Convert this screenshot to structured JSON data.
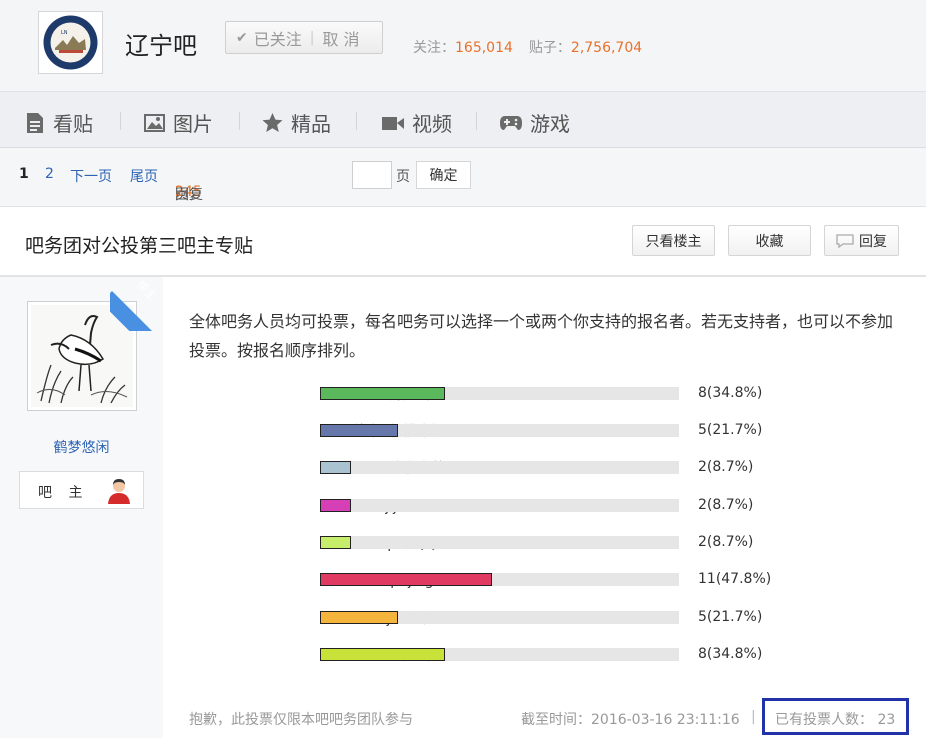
{
  "header": {
    "forum_name": "辽宁吧",
    "follow_button": {
      "check": "✔",
      "followed": "已关注",
      "sep": "|",
      "cancel": "取 消"
    },
    "follow_label": "关注：",
    "follow_count": "165,014",
    "posts_label": "贴子：",
    "posts_count": "2,756,704"
  },
  "nav": {
    "items": [
      {
        "label": "看贴",
        "icon": "document-icon"
      },
      {
        "label": "图片",
        "icon": "image-icon"
      },
      {
        "label": "精品",
        "icon": "star-icon"
      },
      {
        "label": "视频",
        "icon": "video-icon"
      },
      {
        "label": "游戏",
        "icon": "gamepad-icon"
      }
    ]
  },
  "pager": {
    "current": "1",
    "page2": "2",
    "next": "下一页",
    "last": "尾页",
    "reply_count": "245",
    "reply_text": "回复贴，共",
    "total_pages": "2",
    "pages_text": "页，跳到",
    "page_unit": "页",
    "ok": "确定"
  },
  "thread": {
    "title": "吧务团对公投第三吧主专贴",
    "buttons": {
      "only_op": "只看楼主",
      "favorite": "收藏",
      "reply": "回复"
    }
  },
  "post": {
    "badge": "楼主",
    "username": "鹤梦悠闲",
    "role": "吧 主",
    "body": "全体吧务人员均可投票，每名吧务可以选择一个或两个你支持的报名者。若无支持者，也可以不参加投票。按报名顺序排列。"
  },
  "poll": {
    "options": [
      {
        "name": "开元新人：",
        "votes": 8,
        "percent": 34.8,
        "result": "8(34.8%)",
        "color": "#5cb85c"
      },
      {
        "name": "蒙牛6核桃牛奶：",
        "votes": 5,
        "percent": 21.7,
        "result": "5(21.7%)",
        "color": "#6677aa"
      },
      {
        "name": "追求光芒：",
        "votes": 2,
        "percent": 8.7,
        "result": "2(8.7%)",
        "color": "#a9c4d0"
      },
      {
        "name": "jijia1993：",
        "votes": 2,
        "percent": 8.7,
        "result": "2(8.7%)",
        "color": "#d63fb5"
      },
      {
        "name": "q7改QQ1：",
        "votes": 2,
        "percent": 8.7,
        "result": "2(8.7%)",
        "color": "#c6ee6a"
      },
      {
        "name": "pujingw：",
        "votes": 11,
        "percent": 47.8,
        "result": "11(47.8%)",
        "color": "#e03a62"
      },
      {
        "name": "hueijia在路上：",
        "votes": 5,
        "percent": 21.7,
        "result": "5(21.7%)",
        "color": "#f5b53c"
      },
      {
        "name": "万山哥：",
        "votes": 8,
        "percent": 34.8,
        "result": "8(34.8%)",
        "color": "#c8e23a"
      }
    ],
    "footer_note": "抱歉，此投票仅限本吧吧务团队参与",
    "deadline": "截至时间：2016-03-16 23:11:16",
    "pipe": "|",
    "voters_label": "已有投票人数：",
    "voters_count": "23"
  },
  "colors": {
    "link": "#2d64b3",
    "accent": "#e8712b",
    "highlight_box": "#2233aa"
  }
}
